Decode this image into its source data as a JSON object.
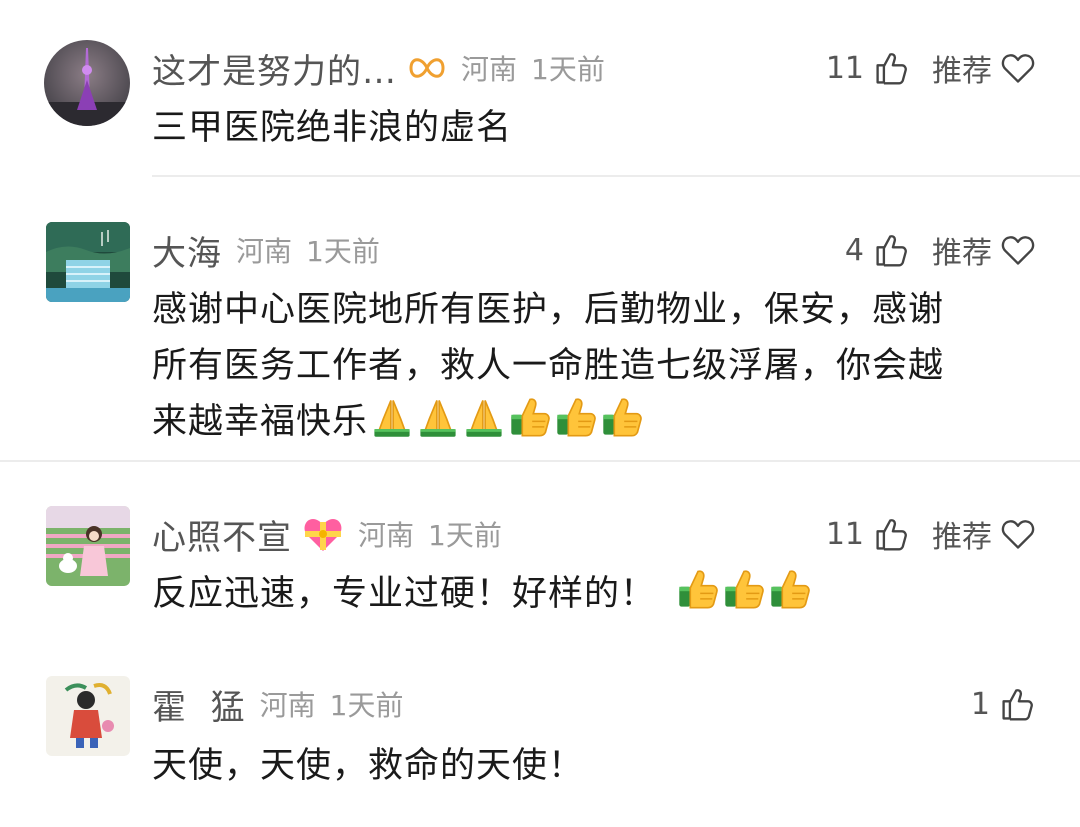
{
  "comments": [
    {
      "name": "这才是努力的…",
      "region": "河南",
      "time": "1天前",
      "likes": "11",
      "recommend": "推荐",
      "text": "三甲医院绝非浪的虚名",
      "badge_icon": "infinity-badge-icon"
    },
    {
      "name": "大海",
      "region": "河南",
      "time": "1天前",
      "likes": "4",
      "recommend": "推荐",
      "text_lines": [
        "感谢中心医院地所有医护，后勤物业，保安，感谢",
        "所有医务工作者，救人一命胜造七级浮屠，你会越",
        "来越幸福快乐"
      ],
      "emojis": [
        "folded-hands",
        "folded-hands",
        "folded-hands",
        "thumbs-up",
        "thumbs-up",
        "thumbs-up"
      ]
    },
    {
      "name": "心照不宣",
      "region": "河南",
      "time": "1天前",
      "likes": "11",
      "recommend": "推荐",
      "text": "反应迅速，专业过硬！好样的！",
      "emojis": [
        "thumbs-up",
        "thumbs-up",
        "thumbs-up"
      ],
      "badge_icon": "heart-with-ribbon-icon"
    },
    {
      "name": "霍  猛",
      "region": "河南",
      "time": "1天前",
      "likes": "1",
      "text": "天使，天使，救命的天使！"
    }
  ],
  "colors": {
    "name": "#555555",
    "meta": "#9a9a9a",
    "text": "#1a1a1a",
    "divider": "#ececec",
    "accent": "#f0a030"
  }
}
